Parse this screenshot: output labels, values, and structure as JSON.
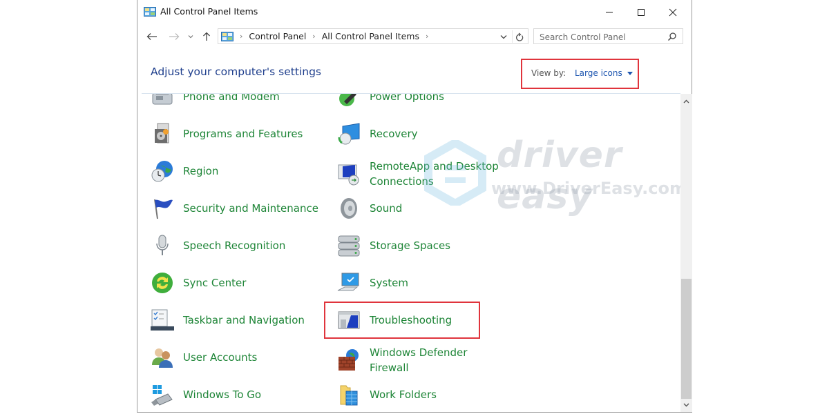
{
  "window": {
    "title": "All Control Panel Items",
    "controls": {
      "minimize": "minimize",
      "maximize": "maximize",
      "close": "close"
    }
  },
  "nav": {
    "breadcrumb": [
      "Control Panel",
      "All Control Panel Items"
    ],
    "search_placeholder": "Search Control Panel",
    "search_value": ""
  },
  "header": {
    "title": "Adjust your computer's settings",
    "view_by_label": "View by:",
    "view_by_value": "Large icons"
  },
  "items": {
    "col1": [
      {
        "label": "Phone and Modem",
        "icon": "phone-modem-icon"
      },
      {
        "label": "Programs and Features",
        "icon": "programs-features-icon"
      },
      {
        "label": "Region",
        "icon": "region-globe-clock-icon"
      },
      {
        "label": "Security and Maintenance",
        "icon": "flag-icon"
      },
      {
        "label": "Speech Recognition",
        "icon": "microphone-icon"
      },
      {
        "label": "Sync Center",
        "icon": "sync-icon"
      },
      {
        "label": "Taskbar and Navigation",
        "icon": "taskbar-icon"
      },
      {
        "label": "User Accounts",
        "icon": "users-icon"
      },
      {
        "label": "Windows To Go",
        "icon": "usb-drive-icon"
      }
    ],
    "col2": [
      {
        "label": "Power Options",
        "icon": "power-plug-icon"
      },
      {
        "label": "Recovery",
        "icon": "recovery-icon"
      },
      {
        "label": "RemoteApp and Desktop Connections",
        "icon": "remote-desktop-icon"
      },
      {
        "label": "Sound",
        "icon": "speaker-icon"
      },
      {
        "label": "Storage Spaces",
        "icon": "storage-icon"
      },
      {
        "label": "System",
        "icon": "computer-icon"
      },
      {
        "label": "Troubleshooting",
        "icon": "troubleshooting-icon"
      },
      {
        "label": "Windows Defender Firewall",
        "icon": "firewall-icon"
      },
      {
        "label": "Work Folders",
        "icon": "work-folders-icon"
      }
    ]
  },
  "highlights": {
    "view_by": "Large icons",
    "item": "Troubleshooting"
  },
  "watermark": {
    "brand": "driver easy",
    "url": "www.DriverEasy.com"
  },
  "colors": {
    "link_green": "#1e8537",
    "heading_blue": "#1e3e8c",
    "highlight_red": "#e0343c",
    "dropdown_blue": "#1e56b0"
  }
}
